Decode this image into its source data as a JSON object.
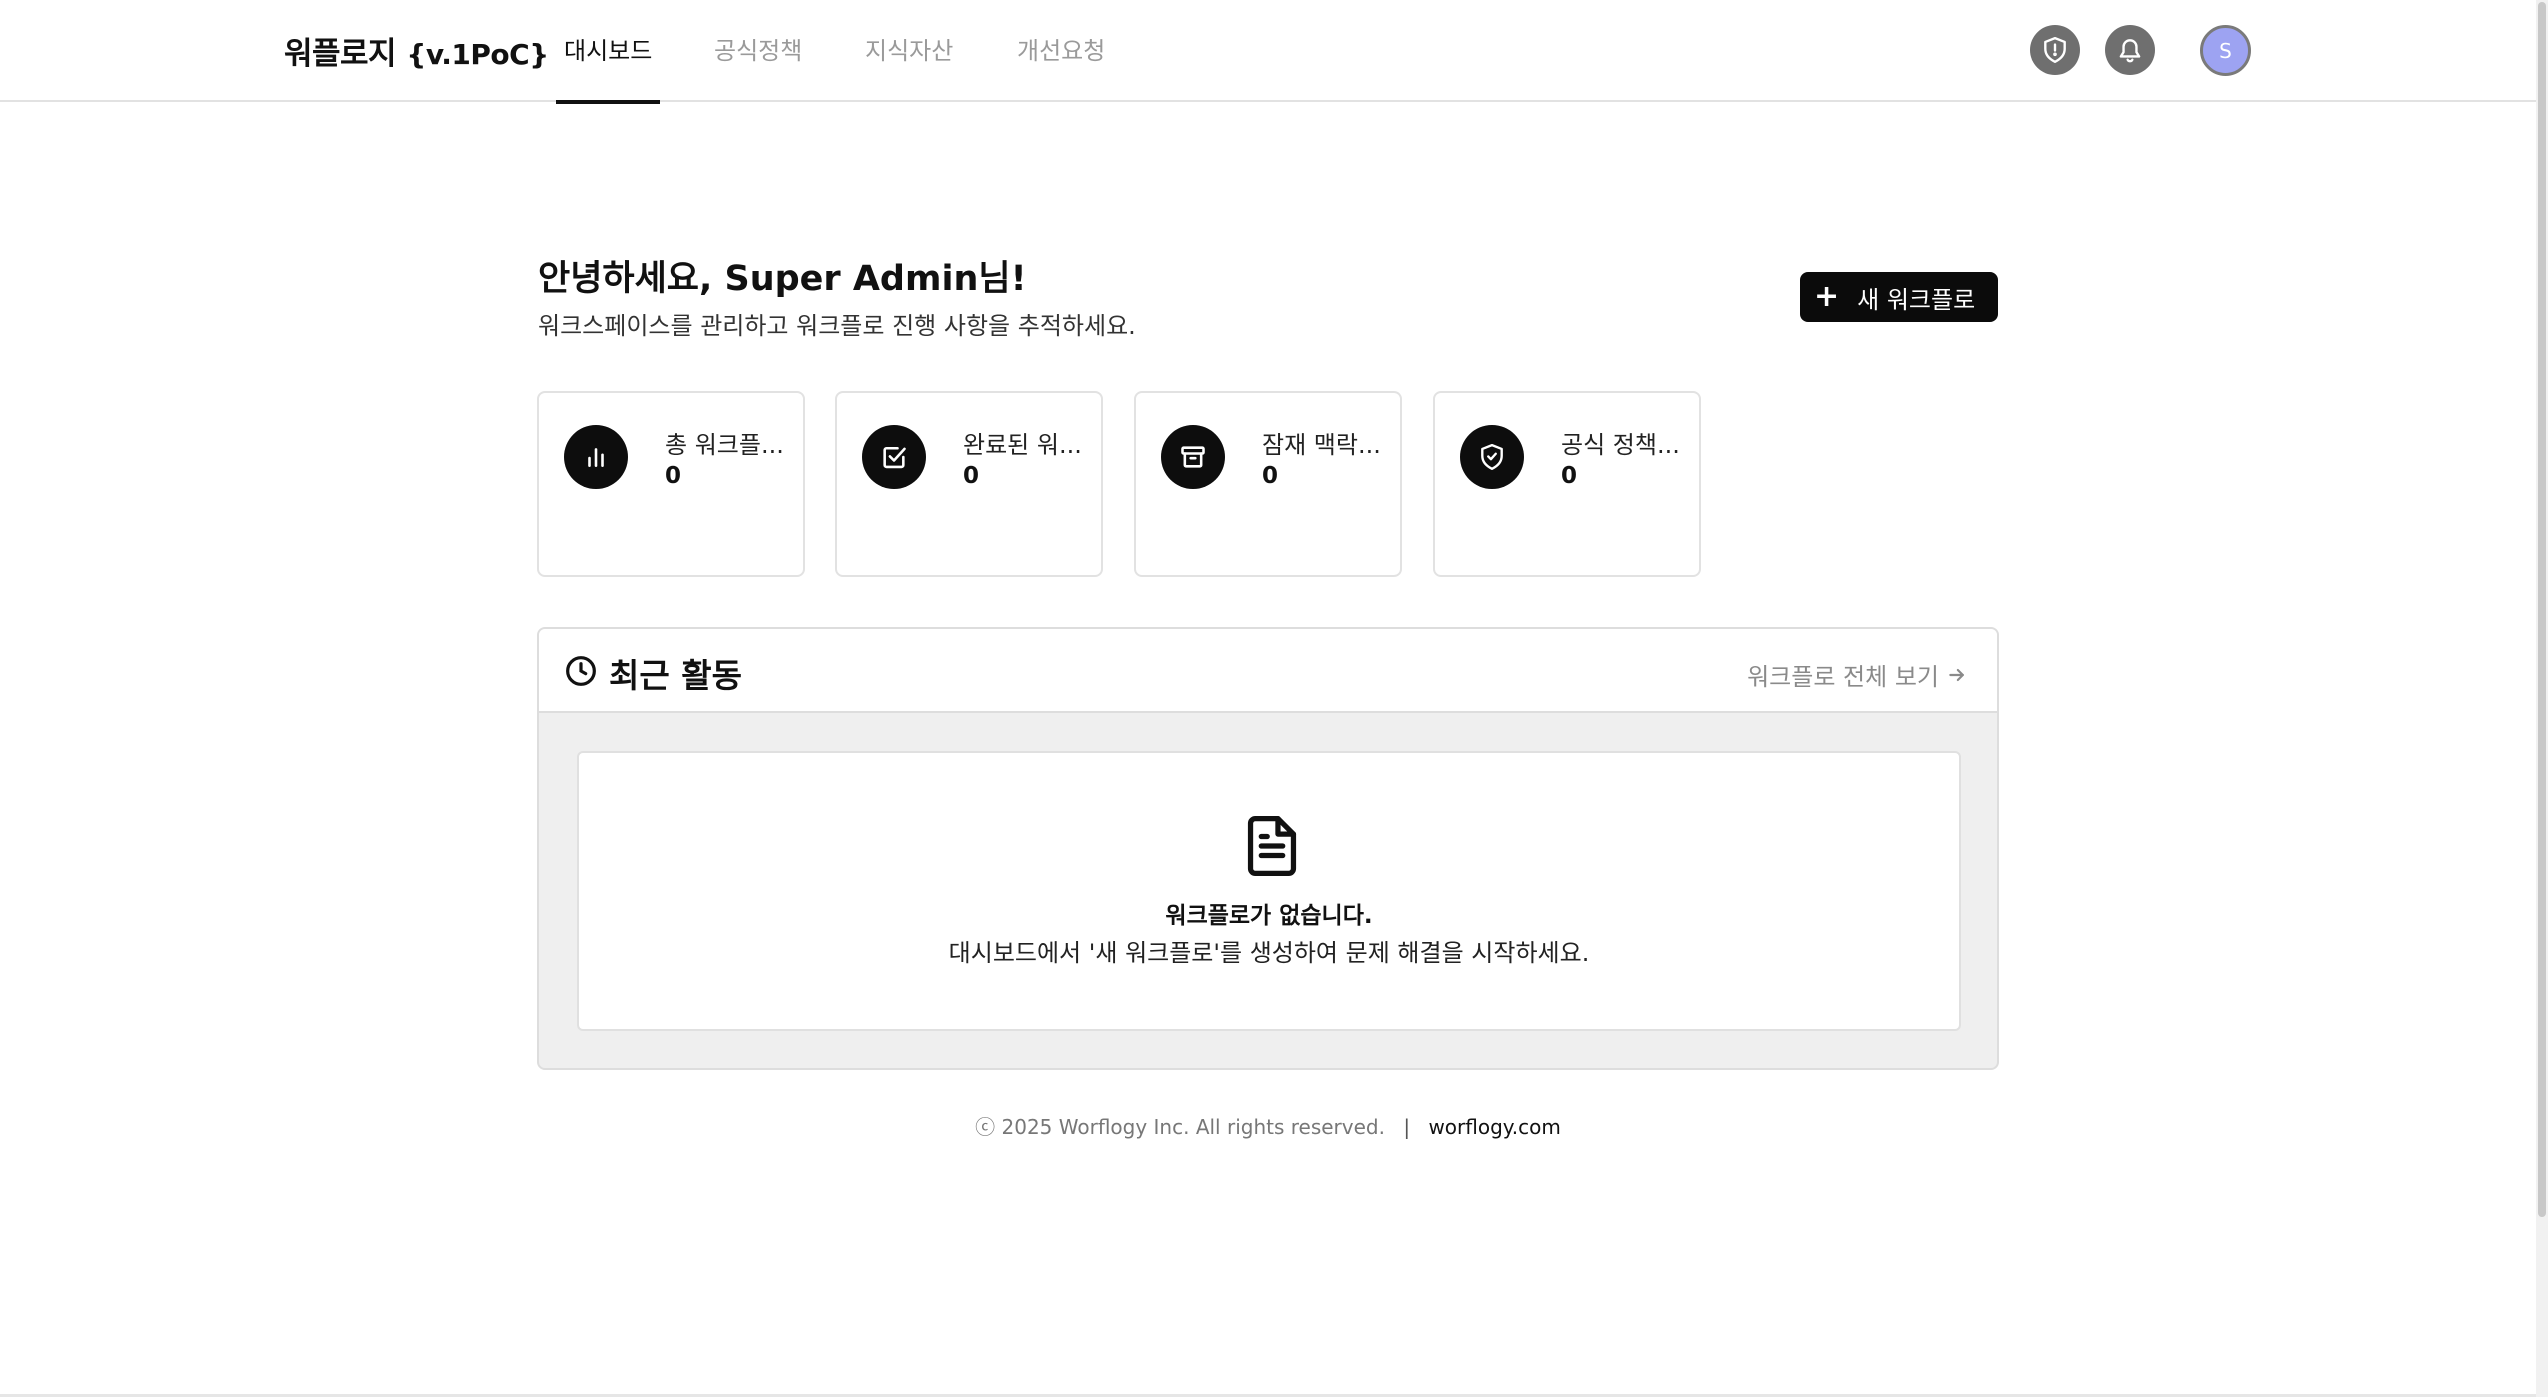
{
  "header": {
    "brand": "워플로지",
    "version": "{v.1PoC}",
    "tabs": [
      {
        "label": "대시보드",
        "active": true
      },
      {
        "label": "공식정책",
        "active": false
      },
      {
        "label": "지식자산",
        "active": false
      },
      {
        "label": "개선요청",
        "active": false
      }
    ],
    "icons": [
      "shield-icon",
      "bell-icon"
    ],
    "avatar_initial": "S"
  },
  "greeting": {
    "title": "안녕하세요, Super Admin님!",
    "subtitle": "워크스페이스를 관리하고 워크플로 진행 사항을 추적하세요."
  },
  "new_workflow_button": {
    "label": "새 워크플로"
  },
  "stats": [
    {
      "label": "총 워크플...",
      "value": "0",
      "icon": "bar-chart-icon"
    },
    {
      "label": "완료된 워...",
      "value": "0",
      "icon": "check-square-icon"
    },
    {
      "label": "잠재 맥락...",
      "value": "0",
      "icon": "archive-icon"
    },
    {
      "label": "공식 정책...",
      "value": "0",
      "icon": "shield-check-icon"
    }
  ],
  "activity": {
    "title": "최근 활동",
    "view_all": "워크플로 전체 보기",
    "empty_title": "워크플로가 없습니다.",
    "empty_subtitle": "대시보드에서 '새 워크플로'를 생성하여 문제 해결을 시작하세요."
  },
  "footer": {
    "copyright": "ⓒ 2025 Worflogy Inc. All rights reserved.",
    "separator": "|",
    "link": "worflogy.com"
  },
  "colors": {
    "primary": "#0b0b0b",
    "muted": "#9a9a9a",
    "avatar": "#9da3f2",
    "header_icon_bg": "#6f6f6f"
  }
}
